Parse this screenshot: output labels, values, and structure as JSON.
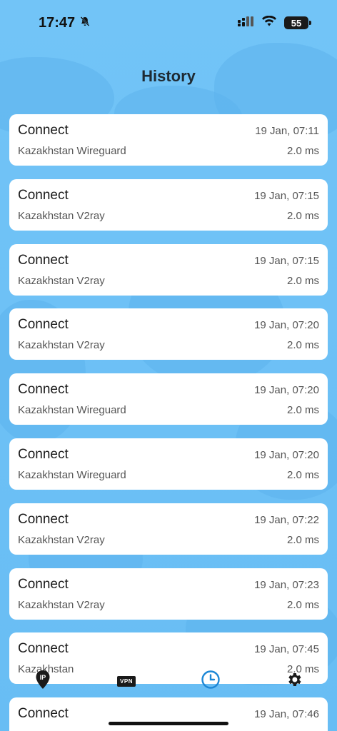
{
  "status": {
    "time": "17:47",
    "battery": "55"
  },
  "title": "History",
  "entries": [
    {
      "action": "Connect",
      "timestamp": "19 Jan, 07:11",
      "server": "Kazakhstan Wireguard",
      "ping": "2.0 ms"
    },
    {
      "action": "Connect",
      "timestamp": "19 Jan, 07:15",
      "server": "Kazakhstan V2ray",
      "ping": "2.0 ms"
    },
    {
      "action": "Connect",
      "timestamp": "19 Jan, 07:15",
      "server": "Kazakhstan V2ray",
      "ping": "2.0 ms"
    },
    {
      "action": "Connect",
      "timestamp": "19 Jan, 07:20",
      "server": "Kazakhstan V2ray",
      "ping": "2.0 ms"
    },
    {
      "action": "Connect",
      "timestamp": "19 Jan, 07:20",
      "server": "Kazakhstan Wireguard",
      "ping": "2.0 ms"
    },
    {
      "action": "Connect",
      "timestamp": "19 Jan, 07:20",
      "server": "Kazakhstan Wireguard",
      "ping": "2.0 ms"
    },
    {
      "action": "Connect",
      "timestamp": "19 Jan, 07:22",
      "server": "Kazakhstan V2ray",
      "ping": "2.0 ms"
    },
    {
      "action": "Connect",
      "timestamp": "19 Jan, 07:23",
      "server": "Kazakhstan V2ray",
      "ping": "2.0 ms"
    },
    {
      "action": "Connect",
      "timestamp": "19 Jan, 07:45",
      "server": "Kazakhstan",
      "ping": "2.0 ms"
    },
    {
      "action": "Connect",
      "timestamp": "19 Jan, 07:46",
      "server": "",
      "ping": ""
    }
  ],
  "tabbar": {
    "vpn_label": "VPN",
    "ip_label": "IP",
    "icons": [
      "location-ip-icon",
      "vpn-icon",
      "history-clock-icon",
      "settings-gear-icon"
    ],
    "active_color": "#1e88d6"
  }
}
